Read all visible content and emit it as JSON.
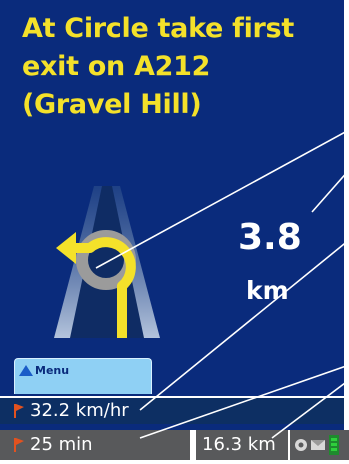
{
  "instruction": {
    "text": "At Circle take first\nexit on A212\n(Gravel Hill)"
  },
  "distance_to_turn": {
    "value": "3.8",
    "unit": "km"
  },
  "menu": {
    "label": "Menu"
  },
  "status": {
    "speed": "32.2 km/hr",
    "time_remaining": "25 min",
    "distance_remaining": "16.3 km"
  },
  "colors": {
    "background": "#0a2b7c",
    "instruction_text": "#f4e12a",
    "arrow": "#f4e12a",
    "roundabout": "#9b9b9b",
    "menu_button": "#8fd0f4",
    "status_bar": "#58595b",
    "flag": "#e2521f"
  },
  "icons": {
    "maneuver": "roundabout-left-arrow-icon",
    "flag": "flag-icon",
    "menu": "triangle-up-icon",
    "status": [
      "gps-icon",
      "message-icon",
      "battery-icon"
    ]
  }
}
